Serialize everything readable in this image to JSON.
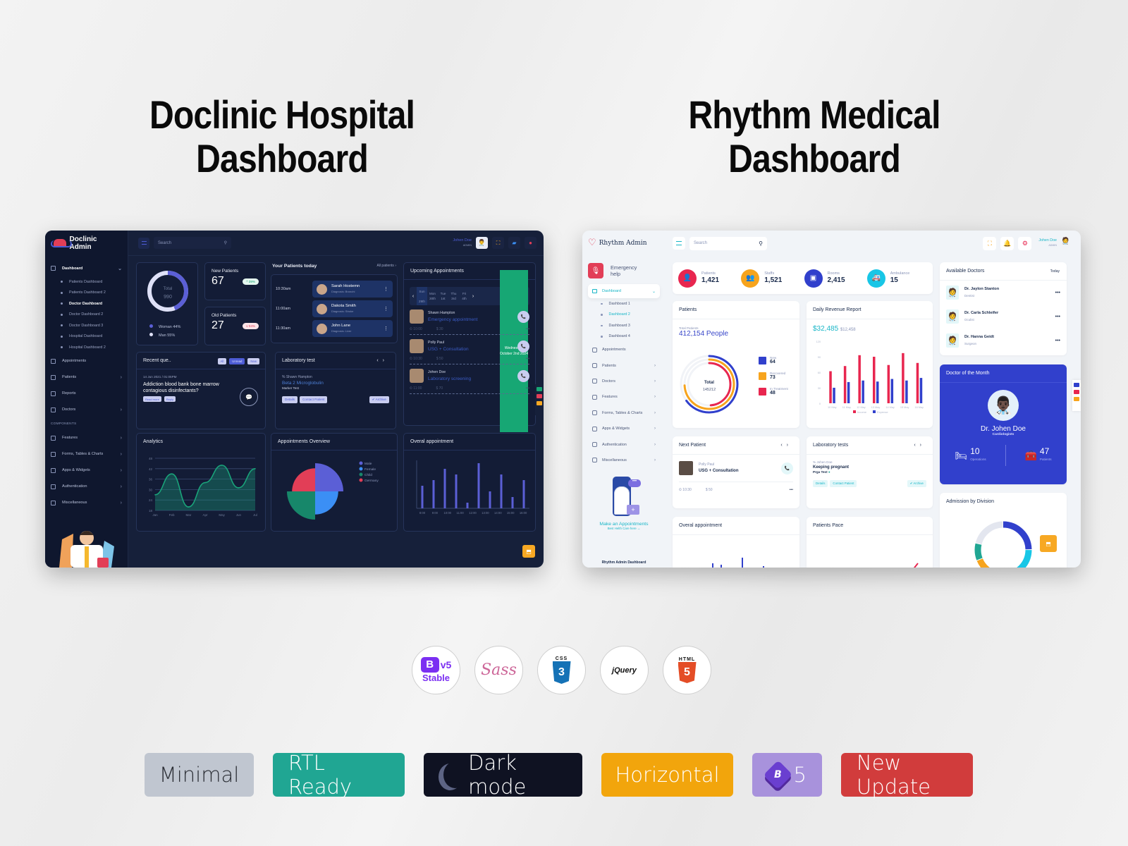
{
  "headlines": {
    "left": [
      "Doclinic Hospital",
      "Dashboard"
    ],
    "right": [
      "Rhythm Medical",
      "Dashboard"
    ]
  },
  "doclinic": {
    "brand": "Doclinic Admin",
    "search_placeholder": "Search",
    "user": {
      "name": "Johen Doe",
      "role": "ADMIN"
    },
    "sidebar": {
      "dashboard": "Dashboard",
      "dashboard_sub": [
        "Patients Dashboard",
        "Patients Dashboard 2",
        "Doctor Dashboard",
        "Doctor Dashboard 2",
        "Doctor Dashboard 3",
        "Hospital Dashboard",
        "Hospital Dashboard 2"
      ],
      "active_sub": "Doctor Dashboard",
      "items": [
        "Appointments",
        "Patients",
        "Reports",
        "Doctors"
      ],
      "section": "COMPONENTS",
      "components": [
        "Features",
        "Forms, Tables & Charts",
        "Apps & Widgets",
        "Authentication",
        "Miscellaneous"
      ]
    },
    "gender_donut": {
      "center_label": "Total",
      "total": "990",
      "legend": [
        {
          "label": "Woman 44%",
          "color": "#5b5fd6"
        },
        {
          "label": "Man 55%",
          "color": "#dfe1f7"
        }
      ],
      "woman_pct": 44,
      "man_pct": 55
    },
    "new_patients": {
      "label": "New Patients",
      "value": "67",
      "change": "^ 39%"
    },
    "old_patients": {
      "label": "Old Patients",
      "value": "27",
      "change": "v 04%"
    },
    "patients_today": {
      "title": "Your Patients today",
      "link": "All patients",
      "rows": [
        {
          "time": "10:30am",
          "name": "Sarah Hostemn",
          "diagnosis": "Diagnosis: Bronchi"
        },
        {
          "time": "11:00am",
          "name": "Dakota Smith",
          "diagnosis": "Diagnosis: Stroke"
        },
        {
          "time": "11:30am",
          "name": "John Lane",
          "diagnosis": "Diagnosis: Liver"
        }
      ]
    },
    "upcoming": {
      "title": "Upcoming Appointments",
      "days": [
        {
          "d": "Sun",
          "n": "29th"
        },
        {
          "d": "Mon",
          "n": "30th"
        },
        {
          "d": "Tue",
          "n": "1st"
        }
      ],
      "today": {
        "d": "Wednesday",
        "n": "October 2nd 2024"
      },
      "days_after": [
        {
          "d": "Thu",
          "n": "3rd"
        },
        {
          "d": "Fri",
          "n": "4th"
        }
      ],
      "items": [
        {
          "name": "Shawn Hampton",
          "type": "Emergency appointment",
          "time": "10:00",
          "price": "$ 30"
        },
        {
          "name": "Polly Paul",
          "type": "USG + Consultation",
          "time": "10:30",
          "price": "$ 50"
        },
        {
          "name": "Johen Doe",
          "type": "Laboratory screening",
          "time": "11:00",
          "price": "$ 70"
        }
      ]
    },
    "recent_questions": {
      "title": "Recent que..",
      "filters": [
        "All",
        "Unread",
        "New"
      ],
      "meta": "14 Jun 2021  /  01:05PM",
      "question": "Addiction blood bank bone marrow contagious disinfectants?",
      "actions": [
        "Read more",
        "Reply"
      ]
    },
    "lab_test": {
      "title": "Laboratory test",
      "patient": "% Shawn Hampton",
      "test": "Beta 2 Microglobulin",
      "marker": "Marker Test",
      "actions": [
        "Details",
        "Contact Patient"
      ],
      "archive": "✔ Archive"
    },
    "analytics_title": "Analytics",
    "appointments_overview_title": "Appointments Overview",
    "overall_title": "Overal appointment"
  },
  "rhythm": {
    "brand": "Rhythm Admin",
    "search_placeholder": "Search",
    "user": {
      "name": "Johen Doe",
      "role": "ADMIN"
    },
    "emergency": "Emergency help",
    "sidebar": {
      "dashboard": "Dashboard",
      "dashboard_sub": [
        "Dashboard 1",
        "Dashboard 2",
        "Dashboard 3",
        "Dashboard 4"
      ],
      "active_sub": "Dashboard 2",
      "items": [
        "Appointments",
        "Patients",
        "Doctors",
        "Features",
        "Forms, Tables & Charts",
        "Apps & Widgets",
        "Authentication",
        "Miscellaneous"
      ]
    },
    "promo": {
      "title": "Make an Appointments",
      "link": "Best Helth Care here →"
    },
    "footer": "Rhythm Admin Dashboard",
    "stats": [
      {
        "label": "Patients",
        "value": "1,421",
        "color": "#e8264f",
        "icon": "👤"
      },
      {
        "label": "Staffs",
        "value": "1,521",
        "color": "#f7a41d",
        "icon": "👥"
      },
      {
        "label": "Rooms",
        "value": "2,415",
        "color": "#3140cc",
        "icon": "▣"
      },
      {
        "label": "Ambulance",
        "value": "15",
        "color": "#18c6e6",
        "icon": "🚑"
      }
    ],
    "patients_card": {
      "title": "Patients",
      "sub": "Total Patients",
      "total": "412,154 People",
      "center_label": "Total",
      "center_value": "145212",
      "legend": [
        {
          "label": "New",
          "value": "64",
          "color": "#3140cc"
        },
        {
          "label": "Recovered",
          "value": "73",
          "color": "#f7a41d"
        },
        {
          "label": "In Treatment",
          "value": "48",
          "color": "#e8264f"
        }
      ]
    },
    "next_patient": {
      "title": "Next Patient",
      "name": "Polly Paul",
      "service": "USG + Consultation",
      "time": "10:30",
      "price": "$ 50"
    },
    "lab_tests": {
      "title": "Laboratory tests",
      "patient": "% Johen Doe",
      "test": "Keeping pregnant",
      "marker": "Prga Test",
      "actions": [
        "Details",
        "Contact Patient"
      ],
      "archive": "✔ Archive"
    },
    "overall_title": "Overal appointment",
    "pace_title": "Patients Pace",
    "available_doctors": {
      "title": "Available Doctors",
      "filter": "Today",
      "items": [
        {
          "name": "Dr. Jaylon Stanton",
          "spec": "Dentist"
        },
        {
          "name": "Dr. Carla Schleifer",
          "spec": "Oculist"
        },
        {
          "name": "Dr. Hanna Geidt",
          "spec": "Surgeon"
        }
      ]
    },
    "doctor_of_month": {
      "title": "Doctor of the Month",
      "name": "Dr. Johen Doe",
      "spec": "Cardiologists",
      "operations": "10",
      "operations_label": "Operations",
      "patients": "47",
      "patients_label": "Patients"
    },
    "admission_title": "Admission by Division"
  },
  "chart_data": [
    {
      "id": "doclinic-analytics",
      "type": "area",
      "title": "Analytics",
      "categories": [
        "Jan",
        "Feb",
        "Mar",
        "Apr",
        "May",
        "Jun",
        "Jul"
      ],
      "values": [
        27,
        39,
        20,
        34,
        44,
        31,
        42
      ],
      "yticks": [
        18,
        24,
        30,
        36,
        42,
        48
      ],
      "ylim": [
        18,
        48
      ],
      "color": "#1aa37a"
    },
    {
      "id": "doclinic-appointments-overview",
      "type": "pie",
      "title": "Appointments Overview",
      "labels": [
        "Male",
        "Female",
        "Child",
        "Germany"
      ],
      "values": [
        25,
        25,
        25,
        25
      ],
      "radius_scale": [
        1.0,
        0.82,
        1.0,
        0.82
      ],
      "colors": [
        "#5b5fd6",
        "#3b8ff5",
        "#17876a",
        "#e23e57"
      ]
    },
    {
      "id": "doclinic-overall",
      "type": "bar",
      "title": "Overal appointment",
      "categories": [
        "8:00",
        "9:00",
        "10:00",
        "11:00",
        "12:00",
        "13:00",
        "14:00",
        "15:00",
        "16:00"
      ],
      "values": [
        40,
        50,
        70,
        60,
        10,
        80,
        30,
        60,
        20,
        50
      ],
      "color": "#5b5fd6"
    },
    {
      "id": "rhythm-revenue",
      "type": "bar",
      "title": "Daily Revenue Report",
      "headline": "$32,485",
      "subvalue": "$12,458",
      "categories": [
        "10 May",
        "11 May",
        "12 May",
        "13 May",
        "14 May",
        "15 May",
        "16 May"
      ],
      "series": [
        {
          "name": "Income",
          "values": [
            62,
            72,
            93,
            90,
            74,
            97,
            78
          ],
          "color": "#e8264f"
        },
        {
          "name": "Expense",
          "values": [
            30,
            41,
            44,
            42,
            47,
            44,
            49
          ],
          "color": "#3140cc"
        }
      ],
      "yticks": [
        0,
        30,
        60,
        90,
        120
      ],
      "ylim": [
        0,
        120
      ]
    },
    {
      "id": "rhythm-patients-radial",
      "type": "pie",
      "title": "Patients",
      "labels": [
        "New",
        "Recovered",
        "In Treatment"
      ],
      "values": [
        64,
        73,
        48
      ],
      "colors": [
        "#3140cc",
        "#f7a41d",
        "#e8264f"
      ]
    },
    {
      "id": "rhythm-admission",
      "type": "pie",
      "title": "Admission by Division",
      "values": [
        25,
        22,
        10,
        12,
        10,
        21
      ],
      "colors": [
        "#3140cc",
        "#18c6e6",
        "#e8264f",
        "#f7a41d",
        "#20a693",
        "#e3e6ef"
      ]
    }
  ],
  "techs": [
    "Bootstrap v5 Stable",
    "Sass",
    "CSS3",
    "jQuery",
    "HTML5"
  ],
  "tech_labels": {
    "bs": "B",
    "v5": "v5",
    "stable": "Stable",
    "sass": "Sass",
    "css": "CSS",
    "css_num": "3",
    "jquery": "jQuery",
    "html": "HTML",
    "html_num": "5"
  },
  "features": [
    {
      "label": "Minimal",
      "color": "#c0c6d0"
    },
    {
      "label": "RTL Ready",
      "color": "#20a693"
    },
    {
      "label": "Dark mode",
      "color": "#0f1222"
    },
    {
      "label": "Horizontal",
      "color": "#f2a50c"
    },
    {
      "label": "5",
      "color": "#a892dc"
    },
    {
      "label": "New Update",
      "color": "#d13c3c"
    }
  ]
}
